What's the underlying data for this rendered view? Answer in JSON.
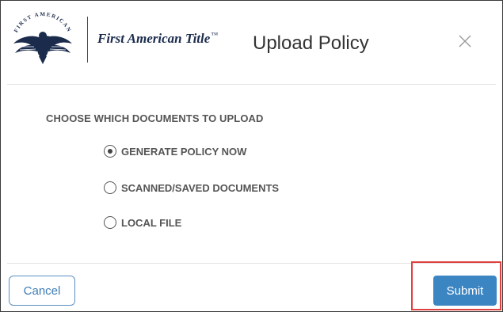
{
  "header": {
    "brand_name": "First American Title",
    "trademark": "™",
    "seal_text": "FIRST AMERICAN",
    "title": "Upload Policy",
    "close_icon": "close-icon"
  },
  "body": {
    "section_label": "CHOOSE WHICH DOCUMENTS TO UPLOAD",
    "options": [
      {
        "label": "GENERATE POLICY NOW",
        "selected": true
      },
      {
        "label": "SCANNED/SAVED DOCUMENTS",
        "selected": false
      },
      {
        "label": "LOCAL FILE",
        "selected": false
      }
    ]
  },
  "footer": {
    "cancel_label": "Cancel",
    "submit_label": "Submit"
  },
  "colors": {
    "brand_navy": "#1a2b4c",
    "accent_red": "#c8102e",
    "primary_blue": "#3c85c3",
    "highlight_red": "#e0413f"
  }
}
